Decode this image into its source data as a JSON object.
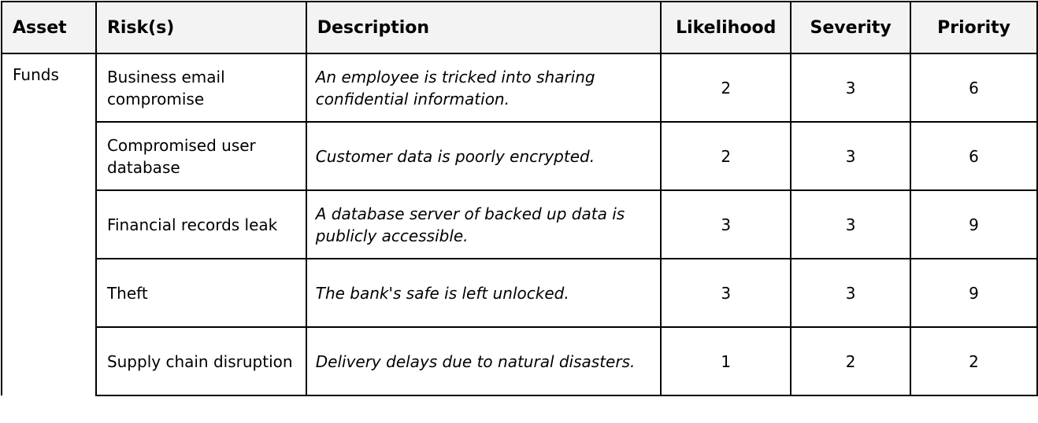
{
  "table": {
    "headers": {
      "asset": "Asset",
      "risks": "Risk(s)",
      "description": "Description",
      "likelihood": "Likelihood",
      "severity": "Severity",
      "priority": "Priority"
    },
    "rows": [
      {
        "asset": "Funds",
        "risk": "Business email compromise",
        "description": "An employee is tricked into sharing confidential information.",
        "likelihood": "2",
        "severity": "3",
        "priority": "6"
      },
      {
        "asset": "",
        "risk": "Compromised user database",
        "description": "Customer data is poorly encrypted.",
        "likelihood": "2",
        "severity": "3",
        "priority": "6"
      },
      {
        "asset": "",
        "risk": "Financial records leak",
        "description": "A database server of backed up data is publicly accessible.",
        "likelihood": "3",
        "severity": "3",
        "priority": "9"
      },
      {
        "asset": "",
        "risk": "Theft",
        "description": "The bank's safe is left unlocked.",
        "likelihood": "3",
        "severity": "3",
        "priority": "9"
      },
      {
        "asset": "",
        "risk": "Supply chain disruption",
        "description": "Delivery delays due to natural disasters.",
        "likelihood": "1",
        "severity": "2",
        "priority": "2"
      }
    ]
  }
}
